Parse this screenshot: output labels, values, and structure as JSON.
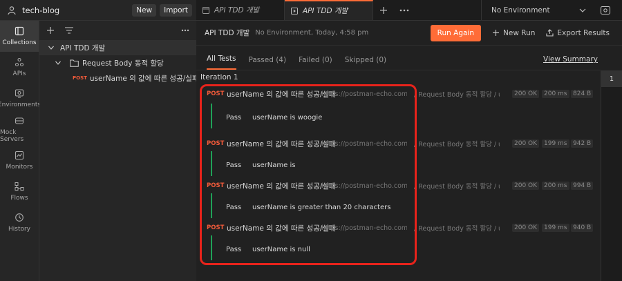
{
  "workspace": {
    "name": "tech-blog",
    "new_label": "New",
    "import_label": "Import"
  },
  "tabs": [
    {
      "label": "API TDD 개발",
      "icon": "collection-icon"
    },
    {
      "label": "API TDD 개발",
      "icon": "runner-icon"
    }
  ],
  "environment": {
    "selected": "No Environment"
  },
  "rail": [
    {
      "label": "Collections",
      "icon": "collections-icon"
    },
    {
      "label": "APIs",
      "icon": "apis-icon"
    },
    {
      "label": "Environments",
      "icon": "environments-icon"
    },
    {
      "label": "Mock Servers",
      "icon": "mock-servers-icon"
    },
    {
      "label": "Monitors",
      "icon": "monitors-icon"
    },
    {
      "label": "Flows",
      "icon": "flows-icon"
    },
    {
      "label": "History",
      "icon": "history-icon"
    }
  ],
  "sidebar": {
    "collection": "API TDD 개발",
    "folder": "Request Body 동적 할당",
    "request": {
      "method": "POST",
      "name": "userName 의 값에 따른 성공/실패"
    }
  },
  "run": {
    "title": "API TDD 개발",
    "meta": "No Environment, Today, 4:58 pm",
    "run_again": "Run Again",
    "new_run": "New Run",
    "export_results": "Export Results"
  },
  "results_tabs": [
    "All Tests",
    "Passed (4)",
    "Failed (0)",
    "Skipped (0)"
  ],
  "view_summary": "View Summary",
  "iteration": {
    "label": "Iteration 1",
    "number": "1"
  },
  "requests": [
    {
      "method": "POST",
      "name": "userName 의 값에 따른 성공/실패",
      "url": "https://postman-echo.com/post",
      "path": "/ Request Body 동적 할당 / u...",
      "status": "200 OK",
      "time": "200 ms",
      "size": "824 B",
      "test_status": "Pass",
      "test_name": "userName is woogie"
    },
    {
      "method": "POST",
      "name": "userName 의 값에 따른 성공/실패",
      "url": "https://postman-echo.com/post",
      "path": "/ Request Body 동적 할당 / u...",
      "status": "200 OK",
      "time": "199 ms",
      "size": "942 B",
      "test_status": "Pass",
      "test_name": "userName is"
    },
    {
      "method": "POST",
      "name": "userName 의 값에 따른 성공/실패",
      "url": "https://postman-echo.com/post",
      "path": "/ Request Body 동적 할당 / u...",
      "status": "200 OK",
      "time": "200 ms",
      "size": "994 B",
      "test_status": "Pass",
      "test_name": "userName is greater than 20 characters"
    },
    {
      "method": "POST",
      "name": "userName 의 값에 따른 성공/실패",
      "url": "https://postman-echo.com/post",
      "path": "/ Request Body 동적 할당 / u...",
      "status": "200 OK",
      "time": "199 ms",
      "size": "940 B",
      "test_status": "Pass",
      "test_name": "userName is null"
    }
  ],
  "colors": {
    "accent": "#ff6c37",
    "pass": "#1fa157",
    "method_post": "#f05a3a",
    "highlight": "#e8231b"
  }
}
